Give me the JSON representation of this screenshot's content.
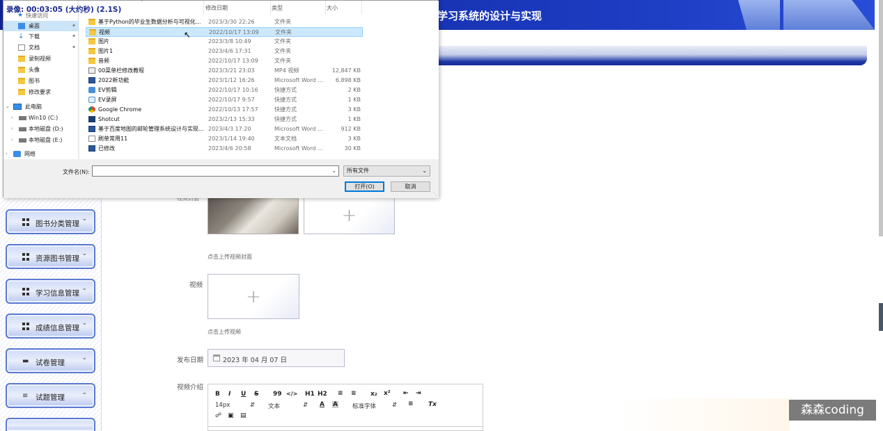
{
  "page": {
    "header_title": "学习系统的设计与实现"
  },
  "sidebar": {
    "items": [
      {
        "label": "图书分类管理",
        "icon": "grid-icon"
      },
      {
        "label": "资源图书管理",
        "icon": "grid-icon"
      },
      {
        "label": "学习信息管理",
        "icon": "grid-icon"
      },
      {
        "label": "成绩信息管理",
        "icon": "grid-icon"
      },
      {
        "label": "试卷管理",
        "icon": "monitor-icon"
      },
      {
        "label": "试题管理",
        "icon": "sliders-icon"
      }
    ]
  },
  "form": {
    "cover_label": "视频封面",
    "cover_hint": "点击上传视频封面",
    "video_label": "视频",
    "video_hint": "点击上传视频",
    "date_label": "发布日期",
    "date_value": "2023 年 04 月 07 日",
    "intro_label": "视频介绍",
    "editor": {
      "font_size": "14px",
      "text_style": "文本",
      "font_family": "标准字体",
      "bold": "B",
      "italic": "I",
      "underline": "U",
      "strike": "S",
      "quote": "99",
      "code": "</>",
      "h1": "H1",
      "h2": "H2",
      "sub": "x₂",
      "sup": "x²",
      "font_color": "A",
      "bg_color": "A",
      "clear": "Tx"
    }
  },
  "dialog": {
    "timer": "录像: 00:03:05 (大约秒) (2.1S)",
    "nav": {
      "quick_access": "快速访问",
      "items": [
        {
          "label": "桌面",
          "pinned": true,
          "selected": true
        },
        {
          "label": "下载",
          "pinned": true
        },
        {
          "label": "文档",
          "pinned": true
        },
        {
          "label": "录制视频"
        },
        {
          "label": "头像"
        },
        {
          "label": "图书"
        },
        {
          "label": "修改要求"
        }
      ],
      "this_pc": "此电脑",
      "drives": [
        "Win10 (C:)",
        "本地磁盘 (D:)",
        "本地磁盘 (E:)"
      ],
      "network": "网络"
    },
    "columns": {
      "date": "修改日期",
      "type": "类型",
      "size": "大小"
    },
    "files": [
      {
        "name": "基于Python的毕业生数据分析与可视化...",
        "date": "2023/3/30 22:26",
        "type": "文件夹",
        "size": "",
        "icon": "folder"
      },
      {
        "name": "视频",
        "date": "2022/10/17 13:09",
        "type": "文件夹",
        "size": "",
        "icon": "folder"
      },
      {
        "name": "图片",
        "date": "2023/3/8 10:49",
        "type": "文件夹",
        "size": "",
        "icon": "folder"
      },
      {
        "name": "图片1",
        "date": "2023/4/6 17:31",
        "type": "文件夹",
        "size": "",
        "icon": "folder"
      },
      {
        "name": "音频",
        "date": "2022/10/17 13:09",
        "type": "文件夹",
        "size": "",
        "icon": "folder"
      },
      {
        "name": "00菜单栏修改教程",
        "date": "2023/3/21 23:03",
        "type": "MP4 视频",
        "size": "12,847 KB",
        "icon": "mp4"
      },
      {
        "name": "2022新功能",
        "date": "2023/1/12 16:26",
        "type": "Microsoft Word ...",
        "size": "6,898 KB",
        "icon": "doc"
      },
      {
        "name": "EV剪辑",
        "date": "2022/10/17 10:16",
        "type": "快捷方式",
        "size": "2 KB",
        "icon": "lnk"
      },
      {
        "name": "EV录屏",
        "date": "2022/10/17 9:57",
        "type": "快捷方式",
        "size": "1 KB",
        "icon": "lnk"
      },
      {
        "name": "Google Chrome",
        "date": "2022/10/13 17:57",
        "type": "快捷方式",
        "size": "3 KB",
        "icon": "chrome"
      },
      {
        "name": "Shotcut",
        "date": "2023/2/13 15:33",
        "type": "快捷方式",
        "size": "1 KB",
        "icon": "shot"
      },
      {
        "name": "基于百度地图的邮轮管理系统设计与实现...",
        "date": "2023/4/3 17:20",
        "type": "Microsoft Word ...",
        "size": "912 KB",
        "icon": "doc"
      },
      {
        "name": "刷单常用11",
        "date": "2023/1/14 19:40",
        "type": "文本文档",
        "size": "3 KB",
        "icon": "txt"
      },
      {
        "name": "已修改",
        "date": "2023/4/6 20:58",
        "type": "Microsoft Word ...",
        "size": "30 KB",
        "icon": "doc"
      }
    ],
    "filename_label": "文件名(N):",
    "filename_value": "",
    "filter_value": "所有文件",
    "open_label": "打开(O)",
    "cancel_label": "取消"
  },
  "watermark": "森森coding"
}
